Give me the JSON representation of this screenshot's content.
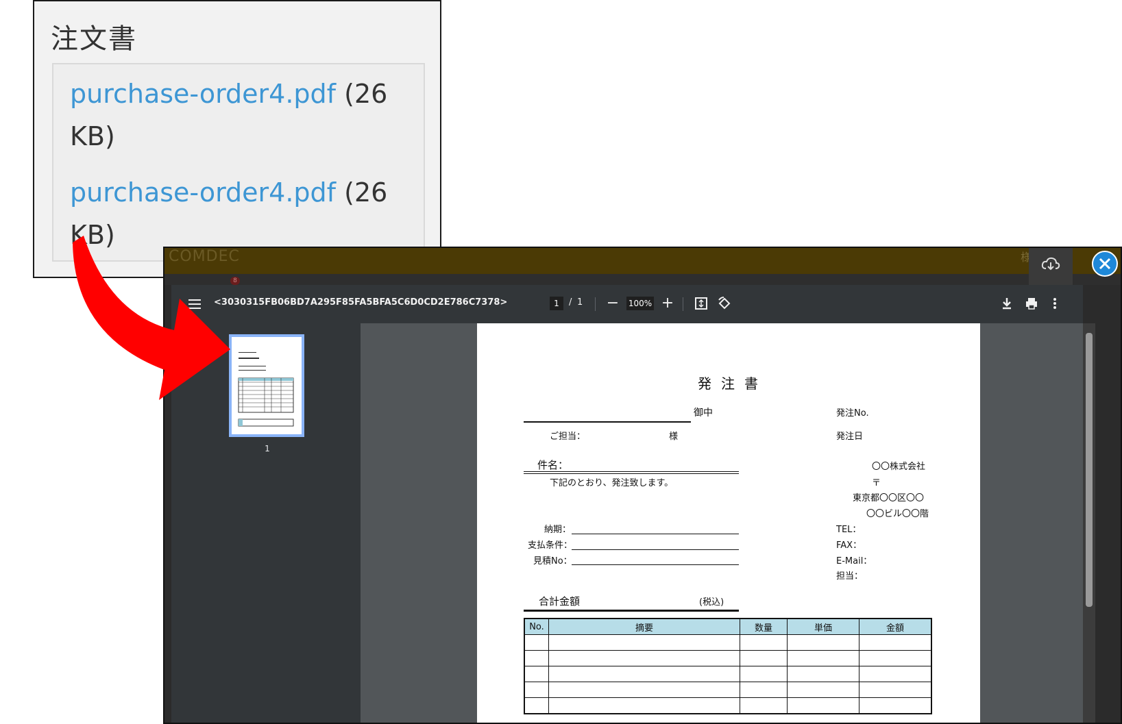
{
  "callout": {
    "title": "注文書",
    "files": [
      {
        "name": "purchase-order4.pdf",
        "size_line1": " (26",
        "size_line2": "KB)"
      },
      {
        "name": "purchase-order4.pdf",
        "size_line1": " (26",
        "size_line2": "KB)"
      }
    ]
  },
  "site": {
    "logo": "COMDEC",
    "header_tail": "様",
    "badge": "8"
  },
  "viewer": {
    "doc_title": "<3030315FB06BD7A295F85FA5BFA5C6D0CD2E786C7378>",
    "page_current": "1",
    "page_sep": "/",
    "page_total": "1",
    "zoom": "100%",
    "zoom_out": "−",
    "zoom_in": "+",
    "thumb_label": "1"
  },
  "document": {
    "title": "発注書",
    "onchu": "御中",
    "tanto": "ご担当：",
    "sama": "様",
    "order_no": "発注No.",
    "order_date": "発注日",
    "subject": "件名：",
    "intro": "下記のとおり、発注致します。",
    "company": "〇〇株式会社",
    "postal": "〒",
    "address1": "東京都〇〇区〇〇",
    "address2": "〇〇ビル〇〇階",
    "tel": "TEL：",
    "fax": "FAX：",
    "email": "E-Mail：",
    "contact": "担当：",
    "deadline": "納期：",
    "payment": "支払条件：",
    "estimate": "見積No：",
    "total": "合計金額",
    "tax_incl": "(税込)",
    "table_headers": [
      "No.",
      "摘要",
      "数量",
      "単価",
      "金額"
    ]
  },
  "colors": {
    "link": "#3d96d4",
    "arrow": "#ff0000",
    "close": "#1e88d8",
    "table_header": "#b7dde8"
  }
}
